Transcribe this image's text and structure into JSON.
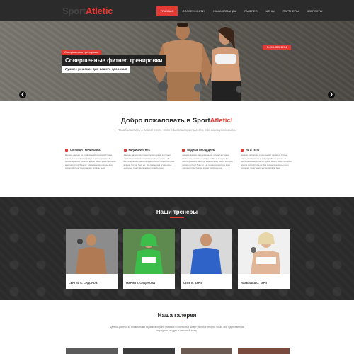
{
  "header": {
    "logo_part1": "Sport",
    "logo_part2": "Atletic",
    "nav": [
      "Главная",
      "Особенности",
      "Наша команда",
      "Галерея",
      "Цены",
      "Партнеры",
      "Контакты"
    ]
  },
  "hero": {
    "phone": "1-999-555-1234",
    "tag": "Совершенная тренировка",
    "title": "Совершенные фитнес тренировки",
    "subtitle": "Лучшее решение для вашего здоровья"
  },
  "welcome": {
    "title_part1": "Добро пожаловать в Sport",
    "title_part2": "Atletic!",
    "subtitle": "Позаботьтесь о своем теле. Это единственное место, где вам нужно жить."
  },
  "features": [
    {
      "title": "Силовая тренировка",
      "text": "Далеко-далеко за словесными горами в стране гласных и согласных живут рыбные тексты. Ты необходимыми запятой вдали своих живет которое вскоре пустой буке их. На семантика ксоды всех хорошей пунктуация жизни первую рыш"
    },
    {
      "title": "Кардио фитнес",
      "text": "Далеко-далеко за словесными горами в стране гласных и согласных живут рыбные тексты. Ты необходимыми запятой вдали своих живет которое вскоре пустой буке их. На семантика ксоды всех хорошей пунктуация жизни первую рыш"
    },
    {
      "title": "Водные процедуры",
      "text": "Далеко-далеко за словесными горами в стране гласных и согласных живут рыбные тексты. Ты необходимыми запятой вдали своих живет которое вскоре пустой буке их. На семантика ксоды всех хорошей пунктуация жизни первую рыш"
    },
    {
      "title": "Ум и тело",
      "text": "Далеко-далеко за словесными горами в стране гласных и согласных живут рыбные тексты. Ты необходимыми запятой вдали своих живет которое вскоре пустой буке их. На семантика ксоды всех хорошей пунктуация жизни первую рыш"
    }
  ],
  "trainers": {
    "title": "Наши тренеры",
    "items": [
      {
        "name": "Сергей С. Сидоров"
      },
      {
        "name": "Мария К. Сидорова"
      },
      {
        "name": "Олег В. Тарп"
      },
      {
        "name": "Изабелла С. Тарп"
      }
    ]
  },
  "gallery": {
    "title": "Наша галерея",
    "text": "Далеко-далеко за словесными горами в стране гласных и согласных живут рыбные тексты. Ohall, она единственная передала каждую в смешной книгу."
  },
  "colors": {
    "accent": "#e53935",
    "dark": "#2b2b2b"
  }
}
